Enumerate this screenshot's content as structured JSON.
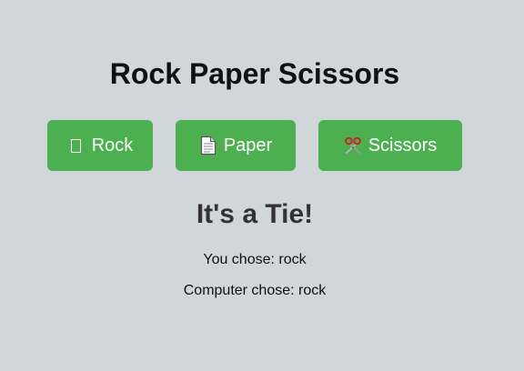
{
  "title": "Rock Paper Scissors",
  "buttons": {
    "rock": {
      "label": "Rock",
      "icon": "rock-icon"
    },
    "paper": {
      "label": "Paper",
      "icon": "page-icon"
    },
    "scissors": {
      "label": "Scissors",
      "icon": "scissors-icon"
    }
  },
  "result": {
    "message": "It's a Tie!",
    "you_chose": "You chose: rock",
    "computer_chose": "Computer chose: rock"
  },
  "colors": {
    "background": "#d1d6da",
    "button": "#4caf50",
    "button_text": "#ffffff",
    "result_text": "#333333"
  }
}
